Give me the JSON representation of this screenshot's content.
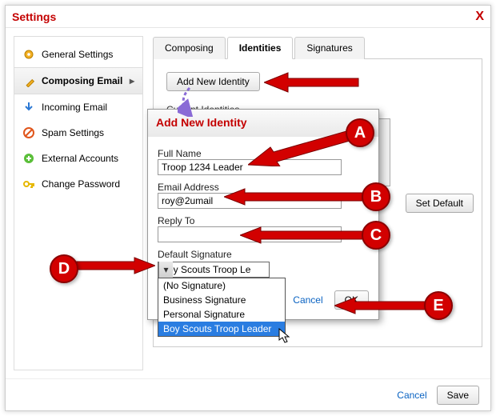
{
  "window": {
    "title": "Settings",
    "close_glyph": "X"
  },
  "sidebar": {
    "items": [
      {
        "label": "General Settings",
        "icon": "gear"
      },
      {
        "label": "Composing Email",
        "icon": "pencil",
        "active": true
      },
      {
        "label": "Incoming Email",
        "icon": "download"
      },
      {
        "label": "Spam Settings",
        "icon": "block"
      },
      {
        "label": "External Accounts",
        "icon": "plus"
      },
      {
        "label": "Change Password",
        "icon": "key"
      }
    ]
  },
  "tabs": {
    "items": [
      {
        "label": "Composing"
      },
      {
        "label": "Identities",
        "active": true
      },
      {
        "label": "Signatures"
      }
    ]
  },
  "identities_panel": {
    "add_button": "Add New Identity",
    "current_label": "Current Identities",
    "set_default_button": "Set Default"
  },
  "modal": {
    "title": "Add New Identity",
    "fullname_label": "Full Name",
    "fullname_value": "Troop 1234 Leader",
    "email_label": "Email Address",
    "email_value": "roy@2umail",
    "replyto_label": "Reply To",
    "replyto_value": "",
    "signature_label": "Default Signature",
    "signature_selected": "Boy Scouts Troop Le",
    "signature_options": [
      "(No Signature)",
      "Business Signature",
      "Personal Signature",
      "Boy Scouts Troop Leader"
    ],
    "signature_highlight_index": 3,
    "cancel_label": "Cancel",
    "ok_label": "OK"
  },
  "footer": {
    "cancel": "Cancel",
    "save": "Save"
  },
  "annotations": {
    "A": "A",
    "B": "B",
    "C": "C",
    "D": "D",
    "E": "E"
  },
  "colors": {
    "accent": "#c40000",
    "annotation": "#d20000",
    "link": "#0a63c2"
  }
}
